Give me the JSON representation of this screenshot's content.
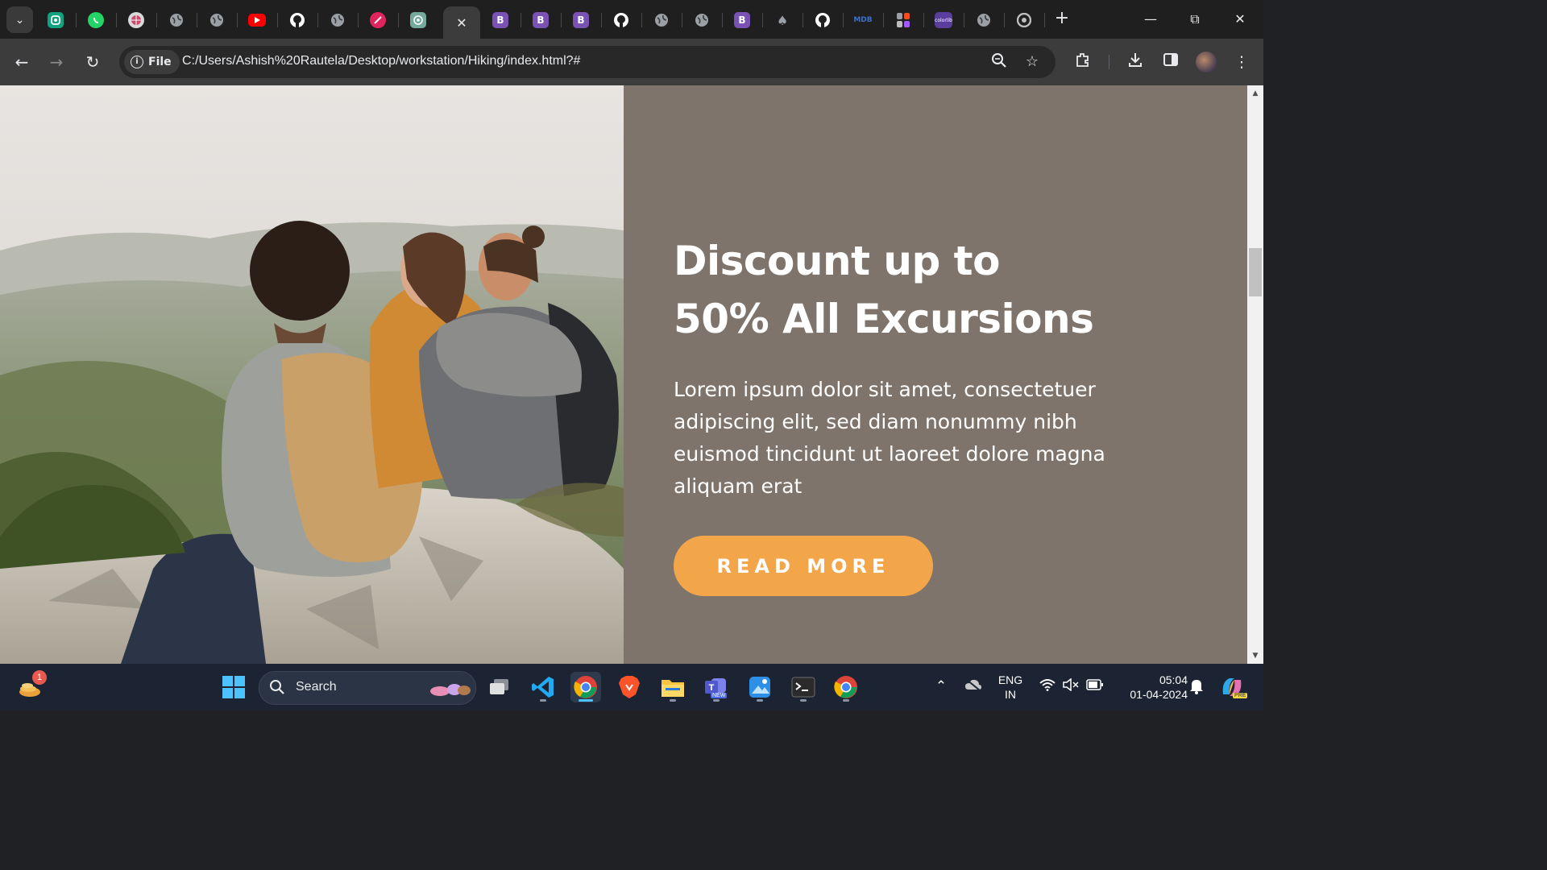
{
  "browser": {
    "tabs": [
      {
        "icon": "tab-search-icon"
      },
      {
        "icon": "chatgpt-alt-icon",
        "color": "#10a37f"
      },
      {
        "icon": "whatsapp-icon",
        "color": "#25d366"
      },
      {
        "icon": "globe-icon"
      },
      {
        "icon": "globe-icon"
      },
      {
        "icon": "globe-icon"
      },
      {
        "icon": "youtube-icon",
        "color": "#ff0000"
      },
      {
        "icon": "github-icon"
      },
      {
        "icon": "globe-icon"
      },
      {
        "icon": "rocket-icon",
        "color": "#e0245e"
      },
      {
        "icon": "chatgpt-icon",
        "color": "#74aa9c"
      },
      {
        "icon": "close-icon",
        "active": true
      },
      {
        "icon": "bootstrap-icon",
        "color": "#7952b3"
      },
      {
        "icon": "bootstrap-icon",
        "color": "#7952b3"
      },
      {
        "icon": "bootstrap-icon",
        "color": "#7952b3"
      },
      {
        "icon": "github-icon"
      },
      {
        "icon": "globe-icon"
      },
      {
        "icon": "globe-icon"
      },
      {
        "icon": "bootstrap-icon",
        "color": "#7952b3"
      },
      {
        "icon": "rabbit-icon"
      },
      {
        "icon": "github-icon"
      },
      {
        "icon": "mdb-icon",
        "color": "#3b71ca"
      },
      {
        "icon": "figma-icon"
      },
      {
        "icon": "colorlib-icon",
        "color": "#5b3d9b"
      },
      {
        "icon": "globe-icon"
      },
      {
        "icon": "chrome-icon"
      }
    ],
    "security_chip": "File",
    "url": "C:/Users/Ashish%20Rautela/Desktop/workstation/Hiking/index.html?#",
    "mdb_label": "MDB",
    "colorlib_label": "colorlib"
  },
  "page": {
    "heading_line1": "Discount up to",
    "heading_line2": "50% All Excursions",
    "body": "Lorem ipsum dolor sit amet, consectetuer adipiscing elit, sed diam nonummy nibh euismod tincidunt ut laoreet dolore magna aliquam erat",
    "button_label": "READ MORE",
    "colors": {
      "panel": "#7e746b",
      "button": "#f3a54a",
      "text": "#ffffff"
    }
  },
  "taskbar": {
    "notification_count": "1",
    "search_label": "Search",
    "language_line1": "ENG",
    "language_line2": "IN",
    "time": "05:04",
    "date": "01-04-2024",
    "teams_badge": "NEW",
    "copilot_badge": "PRE"
  }
}
